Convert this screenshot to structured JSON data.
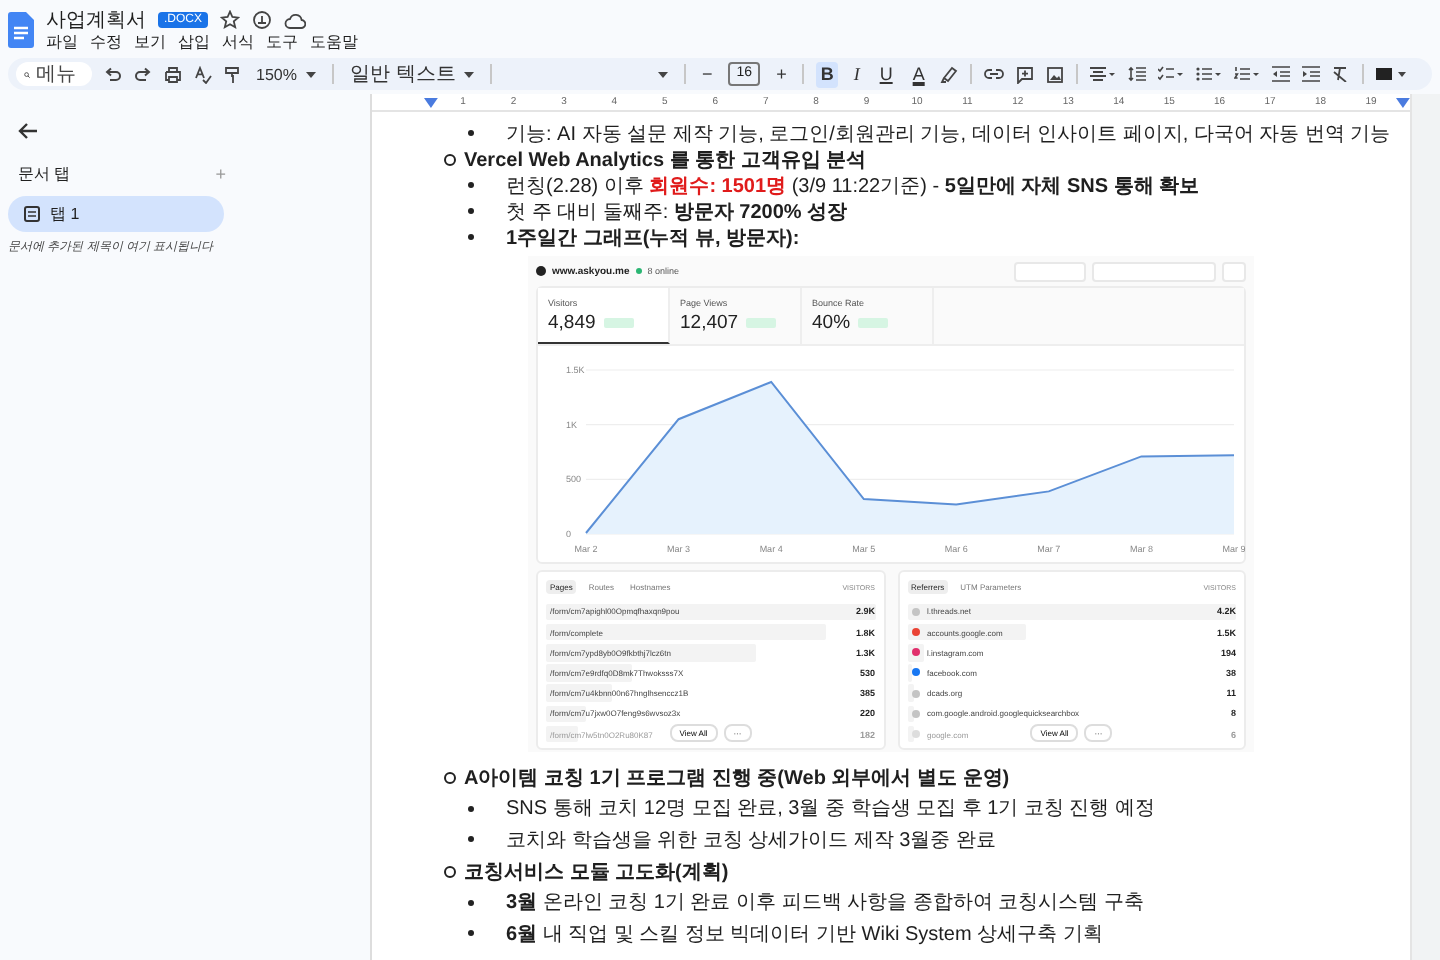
{
  "document": {
    "title": "사업계획서",
    "badge": ".DOCX"
  },
  "menu": [
    "파일",
    "수정",
    "보기",
    "삽입",
    "서식",
    "도구",
    "도움말"
  ],
  "toolbar": {
    "search_placeholder": "메뉴",
    "zoom": "150%",
    "style": "일반 텍스트",
    "decrease": "−",
    "font_size": "16",
    "increase": "+",
    "format_buttons": [
      {
        "label": "B",
        "selected": true
      },
      {
        "label": "I",
        "selected": false
      },
      {
        "label": "U",
        "selected": false
      },
      {
        "label": "A",
        "selected": false
      }
    ]
  },
  "sidebar": {
    "heading": "문서 탭",
    "add": "+",
    "tabs": [
      {
        "label": "탭 1",
        "selected": true
      }
    ],
    "hint": "문서에 추가된 제목이 여기 표시됩니다"
  },
  "ruler": [
    "1",
    "2",
    "3",
    "4",
    "5",
    "6",
    "7",
    "8",
    "9",
    "10",
    "11",
    "12",
    "13",
    "14",
    "15",
    "16",
    "17",
    "18",
    "19"
  ],
  "outline": [
    {
      "kind": "bullet",
      "bold": false,
      "segments": [
        {
          "text": "기능: AI 자동 설문 제작 기능, 로그인/회원관리 기능, 데이터 인사이트 페이지, 다국어 자동 번역 기능"
        }
      ]
    },
    {
      "kind": "circle",
      "bold": true,
      "segments": [
        {
          "text": "Vercel Web Analytics 를 통한 고객유입 분석"
        }
      ],
      "children": [
        {
          "kind": "bullet",
          "bold": false,
          "segments": [
            {
              "text": "런칭(2.28) 이후 "
            },
            {
              "text": "**회원수: 1501명**",
              "color": "#e01b1b"
            },
            {
              "text": " (3/9 11:22기준) - **5일만에 자체 SNS 통해 확보**"
            }
          ]
        },
        {
          "kind": "bullet",
          "bold": false,
          "segments": [
            {
              "text": "첫 주 대비 둘째주: **방문자 7200% 성장**"
            }
          ]
        },
        {
          "kind": "bullet",
          "bold": true,
          "segments": [
            {
              "text": "1주일간 그래프(누적 뷰, 방문자):"
            }
          ]
        }
      ],
      "dashboard": {
        "site": "www.askyou.me",
        "online": "8 online",
        "metrics": [
          {
            "label": "Visitors",
            "value": "4,849",
            "selected": true
          },
          {
            "label": "Page Views",
            "value": "12,407",
            "selected": false
          },
          {
            "label": "Bounce Rate",
            "value": "40%",
            "selected": false
          }
        ],
        "chart_data": {
          "type": "area",
          "categories": [
            "Mar 2",
            "Mar 3",
            "Mar 4",
            "Mar 5",
            "Mar 6",
            "Mar 7",
            "Mar 8",
            "Mar 9"
          ],
          "series": [
            {
              "color": "#5b8fd6",
              "values": [
                10,
                1050,
                1390,
                320,
                270,
                390,
                710,
                720
              ]
            }
          ],
          "ylim": [
            0,
            1500
          ],
          "yticks": [
            0,
            500,
            {
              "value": 1000,
              "label": "1K"
            },
            {
              "value": 1500,
              "label": "1.5K"
            }
          ]
        },
        "panels": [
          {
            "tabs": [
              {
                "label": "Pages",
                "selected": true
              },
              {
                "label": "Routes",
                "selected": false
              },
              {
                "label": "Hostnames",
                "selected": false
              }
            ],
            "column": "VISITORS",
            "view_all": "View All",
            "more": "···",
            "rows": [
              {
                "label": "/form/cm7apighl00Opmqfhaxqn9pou",
                "value": "2.9K",
                "level": 1,
                "faded": false
              },
              {
                "label": "/form/complete",
                "value": "1.8K",
                "level": 0.85,
                "faded": false
              },
              {
                "label": "/form/cm7ypd8yb0O9fkbthj7lcz6tn",
                "value": "1.3K",
                "level": 0.64,
                "faded": false
              },
              {
                "label": "/form/cm7e9rdfq0D8mk7Thwoksss7X",
                "value": "530",
                "level": 0.26,
                "faded": false
              },
              {
                "label": "/form/cm7u4kbnn00n67hnglhsenccz1B",
                "value": "385",
                "level": 0.2,
                "faded": false
              },
              {
                "label": "/form/cm7u7jxw0O7feng9s6wvsoz3x",
                "value": "220",
                "level": 0.12,
                "faded": false
              },
              {
                "label": "/form/cm7lw5tn0O2Ru80K87",
                "value": "182",
                "level": 0.1,
                "faded": true
              }
            ]
          },
          {
            "tabs": [
              {
                "label": "Referrers",
                "selected": true
              },
              {
                "label": "UTM Parameters",
                "selected": false
              }
            ],
            "column": "VISITORS",
            "view_all": "View All",
            "more": "···",
            "rows": [
              {
                "label": "l.threads.net",
                "value": "4.2K",
                "level": 1,
                "faded": false,
                "color": "#c4c4c4"
              },
              {
                "label": "accounts.google.com",
                "value": "1.5K",
                "level": 0.36,
                "faded": false,
                "color": "#ea4335"
              },
              {
                "label": "l.instagram.com",
                "value": "194",
                "level": 0.05,
                "faded": false,
                "color": "#e1306c"
              },
              {
                "label": "facebook.com",
                "value": "38",
                "level": 0.01,
                "faded": false,
                "color": "#1877f2"
              },
              {
                "label": "dcads.org",
                "value": "11",
                "level": 0.02,
                "faded": false,
                "color": "#c4c4c4"
              },
              {
                "label": "com.google.android.googlequicksearchbox",
                "value": "8",
                "level": 0.02,
                "faded": false,
                "color": "#c4c4c4"
              },
              {
                "label": "google.com",
                "value": "6",
                "level": 0.02,
                "faded": true,
                "color": "#dddddd"
              }
            ]
          }
        ]
      }
    },
    {
      "kind": "circle",
      "bold": true,
      "segments": [
        {
          "text": "A아이템 코칭 1기 프로그램 진행 중(Web 외부에서 별도 운영)"
        }
      ],
      "children": [
        {
          "kind": "bullet",
          "bold": false,
          "segments": [
            {
              "text": "SNS 통해 코치 12명 모집 완료, 3월 중 학습생 모집 후 1기 코칭 진행 예정"
            }
          ]
        },
        {
          "kind": "bullet",
          "bold": false,
          "segments": [
            {
              "text": "코치와 학습생을 위한 코칭 상세가이드 제작 3월중 완료"
            }
          ]
        }
      ]
    },
    {
      "kind": "circle",
      "bold": true,
      "segments": [
        {
          "text": "코칭서비스 모듈 고도화(계획)"
        }
      ],
      "children": [
        {
          "kind": "bullet",
          "bold": false,
          "segments": [
            {
              "text": "**3월** 온라인 코칭 1기 완료 이후 피드백 사항을 종합하여 코칭시스템 구축"
            }
          ]
        },
        {
          "kind": "bullet",
          "bold": false,
          "segments": [
            {
              "text": "**6월** 내 직업 및 스킬 정보 빅데이터 기반 Wiki System 상세구축 기획"
            }
          ]
        }
      ]
    }
  ]
}
